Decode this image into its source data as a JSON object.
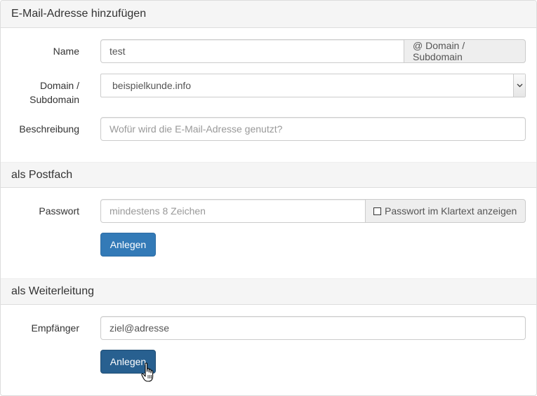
{
  "sections": {
    "add_email": "E-Mail-Adresse hinzufügen",
    "mailbox": "als Postfach",
    "forwarding": "als Weiterleitung"
  },
  "form": {
    "name_label": "Name",
    "name_value": "test",
    "domain_addon": "@ Domain / Subdomain",
    "domain_label_line1": "Domain /",
    "domain_label_line2": "Subdomain",
    "domain_selected": "beispielkunde.info",
    "description_label": "Beschreibung",
    "description_placeholder": "Wofür wird die E-Mail-Adresse genutzt?"
  },
  "mailbox": {
    "password_label": "Passwort",
    "password_placeholder": "mindestens 8 Zeichen",
    "show_password_label": "Passwort im Klartext anzeigen",
    "create_button": "Anlegen"
  },
  "forwarding": {
    "recipient_label": "Empfänger",
    "recipient_value": "ziel@adresse",
    "create_button": "Anlegen"
  },
  "icons": {
    "select_arrow": "chevron-down-icon",
    "cursor": "hand-pointer-icon"
  },
  "colors": {
    "primary": "#337ab7",
    "primary_active": "#286090",
    "heading_bg": "#f5f5f5"
  }
}
